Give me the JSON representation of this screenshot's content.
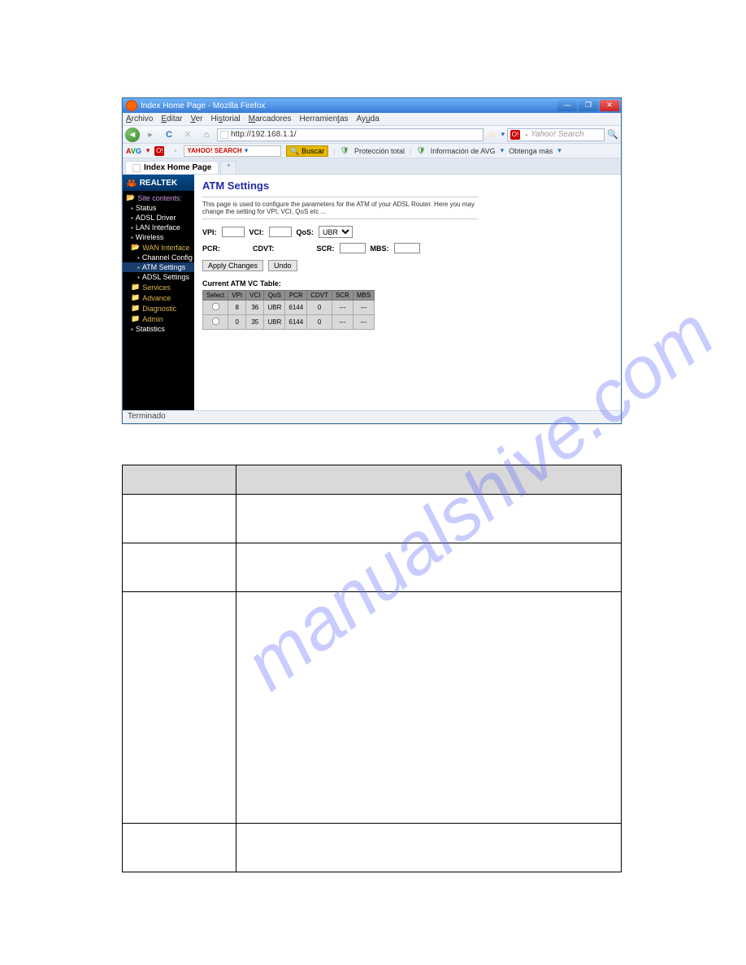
{
  "titlebar": {
    "text": "Index Home Page - Mozilla Firefox"
  },
  "menubar": [
    "Archivo",
    "Editar",
    "Ver",
    "Historial",
    "Marcadores",
    "Herramientas",
    "Ayuda"
  ],
  "navbar": {
    "url": "http://192.168.1.1/",
    "search_placeholder": "Yahoo! Search"
  },
  "toolbar2": {
    "avg": "AVG",
    "yahoo_label": "YAHOO! SEARCH",
    "buscar": "Buscar",
    "proteccion": "Protección total",
    "info": "Información de AVG",
    "obtenga": "Obtenga más"
  },
  "tab": {
    "label": "Index Home Page"
  },
  "sidebar": {
    "logo": "REALTEK",
    "header": "Site contents:",
    "items": [
      {
        "label": "Status",
        "level": 1
      },
      {
        "label": "ADSL Driver",
        "level": 1
      },
      {
        "label": "LAN Interface",
        "level": 1
      },
      {
        "label": "Wireless",
        "level": 1
      },
      {
        "label": "WAN Interface",
        "level": 1,
        "open": true
      },
      {
        "label": "Channel Config",
        "level": 2
      },
      {
        "label": "ATM Settings",
        "level": 2,
        "selected": true
      },
      {
        "label": "ADSL Settings",
        "level": 2
      },
      {
        "label": "Services",
        "level": 1,
        "folder": true
      },
      {
        "label": "Advance",
        "level": 1,
        "folder": true
      },
      {
        "label": "Diagnostic",
        "level": 1,
        "folder": true
      },
      {
        "label": "Admin",
        "level": 1,
        "folder": true
      },
      {
        "label": "Statistics",
        "level": 1
      }
    ]
  },
  "main": {
    "title": "ATM Settings",
    "desc": "This page is used to configure the parameters for the ATM of your ADSL Router. Here you may change the setting for VPI, VCI, QoS etc ...",
    "labels": {
      "vpi": "VPI:",
      "vci": "VCI:",
      "qos": "QoS:",
      "qos_value": "UBR",
      "pcr": "PCR:",
      "cdvt": "CDVT:",
      "scr": "SCR:",
      "mbs": "MBS:"
    },
    "buttons": {
      "apply": "Apply Changes",
      "undo": "Undo"
    },
    "table_caption": "Current ATM VC Table:",
    "table_headers": [
      "Select",
      "VPI",
      "VCI",
      "QoS",
      "PCR",
      "CDVT",
      "SCR",
      "MBS"
    ],
    "table_rows": [
      {
        "vpi": "8",
        "vci": "36",
        "qos": "UBR",
        "pcr": "6144",
        "cdvt": "0",
        "scr": "---",
        "mbs": "---"
      },
      {
        "vpi": "0",
        "vci": "35",
        "qos": "UBR",
        "pcr": "6144",
        "cdvt": "0",
        "scr": "---",
        "mbs": "---"
      }
    ]
  },
  "statusbar": {
    "text": "Terminado"
  },
  "watermark": "manualshive.com"
}
